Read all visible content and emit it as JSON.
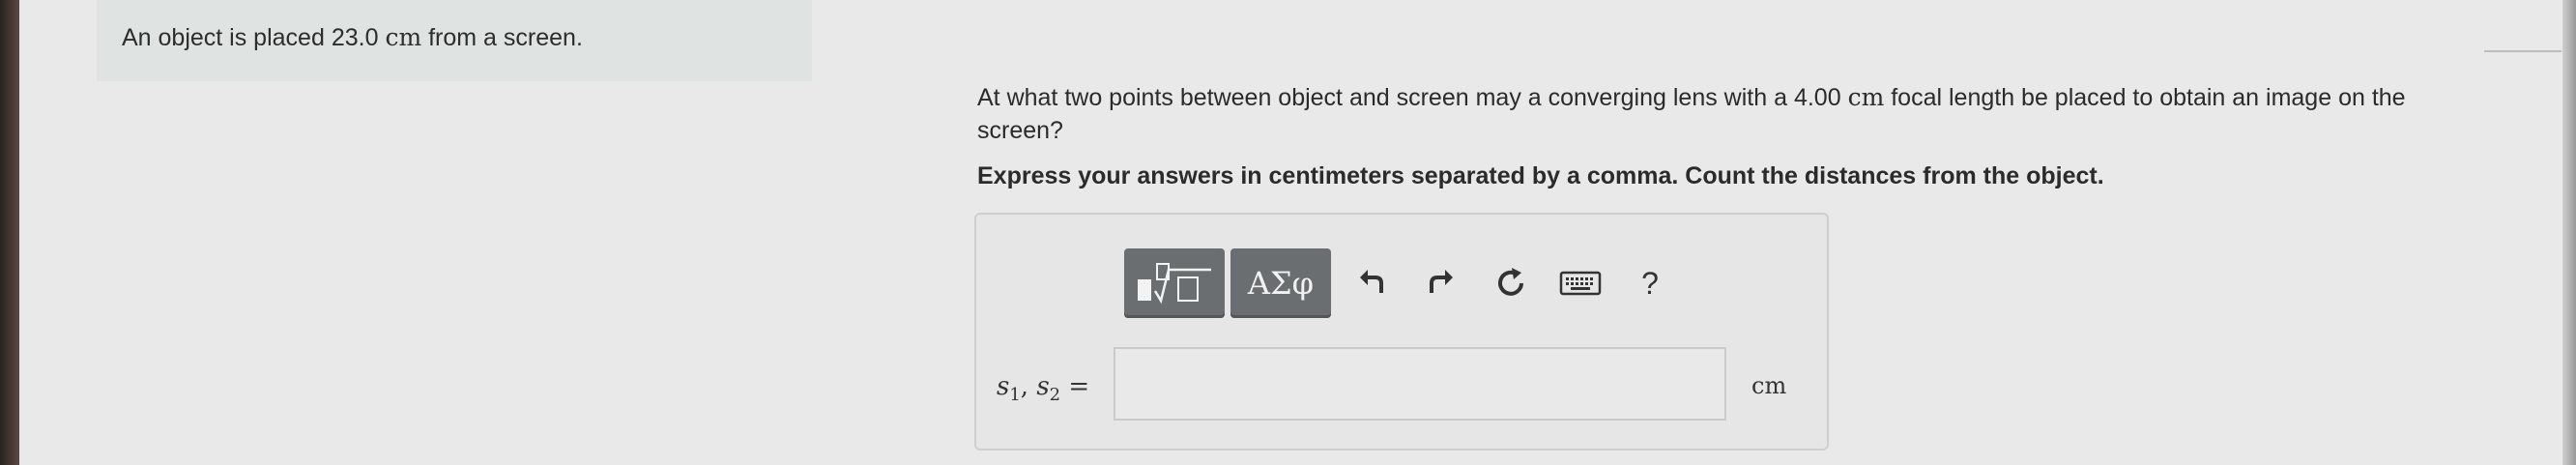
{
  "intro": {
    "text_before": "An object is placed",
    "value": "23.0",
    "unit": "cm",
    "text_after": "from a screen."
  },
  "question": {
    "text_before": "At what two points between object and screen may a converging lens with a",
    "value": "4.00",
    "unit": "cm",
    "text_after": "focal length be placed to obtain an image on the screen?"
  },
  "instruction": "Express your answers in centimeters separated by a comma. Count the distances from the object.",
  "toolbar": {
    "templates_icon": "templates-icon",
    "symbols_label": "ΑΣφ",
    "undo_icon": "undo-icon",
    "redo_icon": "redo-icon",
    "reset_icon": "reset-icon",
    "keyboard_icon": "keyboard-icon",
    "help_label": "?"
  },
  "answer": {
    "var1": "s",
    "var1_sub": "1",
    "separator": ", ",
    "var2": "s",
    "var2_sub": "2",
    "equals": " =",
    "value": "",
    "unit": "cm"
  }
}
